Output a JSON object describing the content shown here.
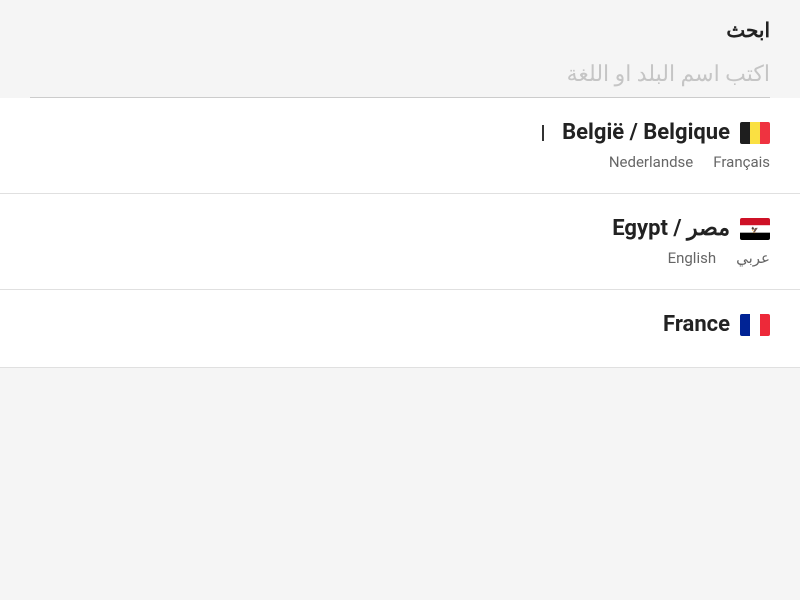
{
  "header": {
    "title": "ابحث",
    "search_placeholder": "اكتب اسم البلد او اللغة"
  },
  "countries": [
    {
      "id": "belgium",
      "name": "België / Belgique",
      "flag_code": "be",
      "languages": [
        "Nederlandse",
        "Français"
      ]
    },
    {
      "id": "egypt",
      "name": "Egypt / مصر",
      "flag_code": "eg",
      "languages": [
        "English",
        "عربي"
      ]
    },
    {
      "id": "france",
      "name": "France",
      "flag_code": "fr",
      "languages": []
    }
  ]
}
